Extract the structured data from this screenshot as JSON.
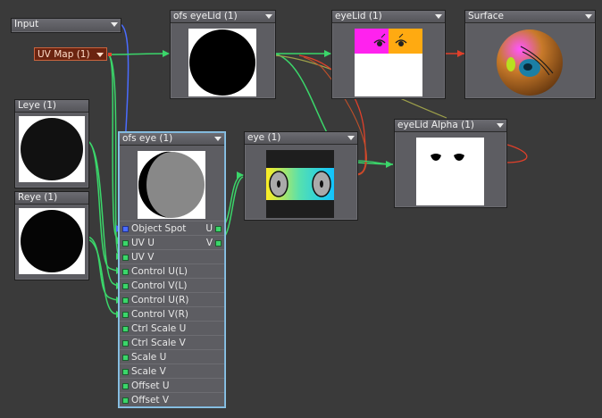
{
  "colors": {
    "background": "#3a3a3a",
    "node": "#5d5d62",
    "wire_green": "#3bd66a",
    "wire_blue": "#4a6cff",
    "wire_red": "#e0402a",
    "selected_border": "#7db3d8"
  },
  "nodes": {
    "input": {
      "title": "Input"
    },
    "uv_map": {
      "title": "UV Map (1)"
    },
    "leye": {
      "title": "Leye (1)"
    },
    "reye": {
      "title": "Reye (1)"
    },
    "ofs_eyelid": {
      "title": "ofs eyeLid (1)"
    },
    "eyelid": {
      "title": "eyeLid (1)"
    },
    "surface": {
      "title": "Surface"
    },
    "eyelid_alpha": {
      "title": "eyeLid Alpha (1)"
    },
    "eye": {
      "title": "eye (1)"
    },
    "ofs_eye": {
      "title": "ofs eye (1)",
      "outputs": [
        "U",
        "V"
      ],
      "inputs": [
        "Object Spot",
        "UV U",
        "UV V",
        "Control U(L)",
        "Control V(L)",
        "Control U(R)",
        "Control V(R)",
        "Ctrl Scale U",
        "Ctrl Scale V",
        "Scale U",
        "Scale V",
        "Offset U",
        "Offset V"
      ]
    }
  }
}
